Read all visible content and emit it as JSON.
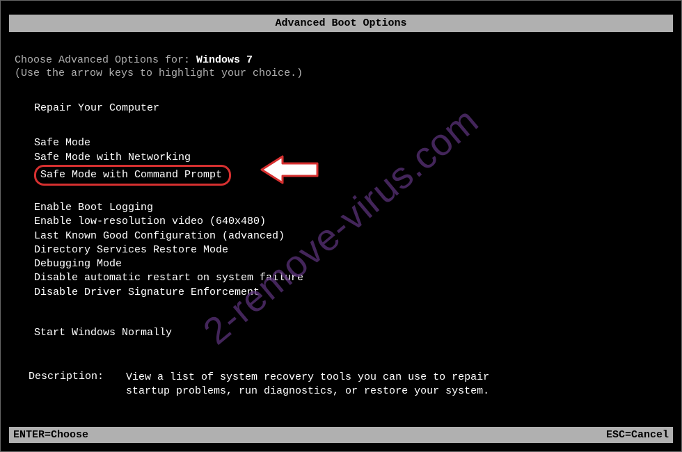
{
  "title": "Advanced Boot Options",
  "intro": {
    "prefix": "Choose Advanced Options for: ",
    "os": "Windows 7",
    "hint": "(Use the arrow keys to highlight your choice.)"
  },
  "menu": {
    "repair": "Repair Your Computer",
    "safe_mode": "Safe Mode",
    "safe_mode_net": "Safe Mode with Networking",
    "safe_mode_cmd": "Safe Mode with Command Prompt",
    "boot_logging": "Enable Boot Logging",
    "low_res": "Enable low-resolution video (640x480)",
    "last_known": "Last Known Good Configuration (advanced)",
    "ds_restore": "Directory Services Restore Mode",
    "debugging": "Debugging Mode",
    "disable_restart": "Disable automatic restart on system failure",
    "disable_sig": "Disable Driver Signature Enforcement",
    "start_normal": "Start Windows Normally"
  },
  "description": {
    "label": "Description:",
    "text_line1": "View a list of system recovery tools you can use to repair",
    "text_line2": "startup problems, run diagnostics, or restore your system."
  },
  "footer": {
    "enter": "ENTER=Choose",
    "esc": "ESC=Cancel"
  },
  "watermark": "2-remove-virus.com"
}
